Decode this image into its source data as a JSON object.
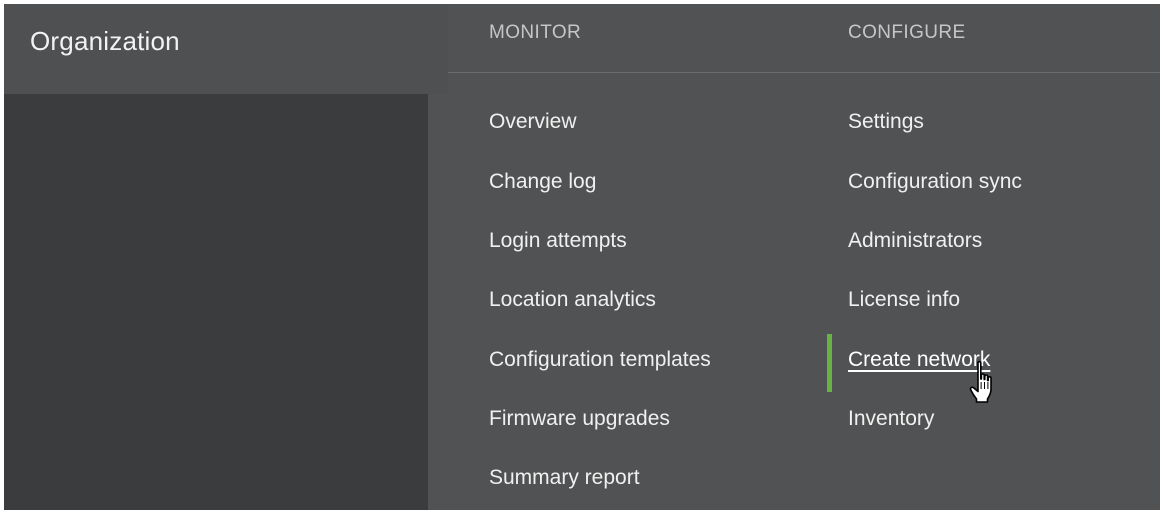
{
  "sidebar": {
    "title": "Organization"
  },
  "menu": {
    "monitor": {
      "header": "MONITOR",
      "items": [
        "Overview",
        "Change log",
        "Login attempts",
        "Location analytics",
        "Configuration templates",
        "Firmware upgrades",
        "Summary report"
      ]
    },
    "configure": {
      "header": "CONFIGURE",
      "items": [
        "Settings",
        "Configuration sync",
        "Administrators",
        "License info",
        "Create network",
        "Inventory"
      ],
      "active_item": "Create network"
    }
  },
  "colors": {
    "menu_background": "#515253",
    "sidebar_background": "#3b3c3d",
    "active_indicator": "#67b346"
  },
  "cursor": {
    "icon": "hand-pointer-icon"
  }
}
